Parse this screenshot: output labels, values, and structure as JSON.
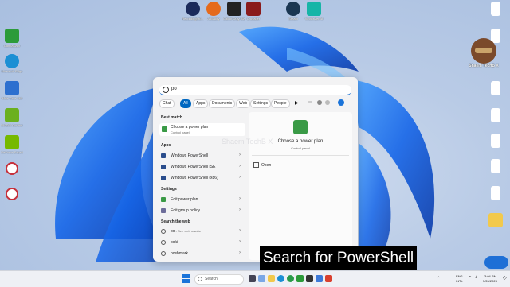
{
  "desktop_left": [
    {
      "label": "Camtasia 9",
      "color": "#2c9b3a"
    },
    {
      "label": "Microsoft Edge",
      "color": "#1b8fd4"
    },
    {
      "label": "Wise Care 365",
      "color": "#2c6fcf"
    },
    {
      "label": "NVIDIA Control Panel",
      "color": "#6bb01f"
    },
    {
      "label": "GeForce Experience",
      "color": "#76b900"
    },
    {
      "label": "",
      "color": "#c6303b"
    },
    {
      "label": "",
      "color": "#c6303b"
    }
  ],
  "desktop_top": [
    {
      "label": "RecordingStu...",
      "color": "#1b2a5a"
    },
    {
      "label": "Audacity",
      "color": "#e56a1c"
    },
    {
      "label": "Call of Duty Black Ops 3",
      "color": "#222222"
    },
    {
      "label": "Crusader",
      "color": "#8a1b1b"
    },
    {
      "label": "Steam",
      "color": "#1a3652"
    },
    {
      "label": "Vectorizer.AI",
      "color": "#17b5a7"
    }
  ],
  "desktop_right": [
    {
      "label": "Shaem TechB X",
      "color": "#ffffff"
    },
    {
      "label": "",
      "color": "#ffffff"
    },
    {
      "label": "",
      "color": "#ffffff"
    },
    {
      "label": "",
      "color": "#ffffff"
    },
    {
      "label": "",
      "color": "#ffffff"
    },
    {
      "label": "",
      "color": "#ffffff"
    },
    {
      "label": "",
      "color": "#ffffff"
    },
    {
      "label": "",
      "color": "#f2c94c"
    }
  ],
  "profile": {
    "label": "Shaem TechB X"
  },
  "start_menu": {
    "search_value": "po",
    "filters": [
      "Chat",
      "All",
      "Apps",
      "Documents",
      "Web",
      "Settings",
      "People"
    ],
    "best_match_header": "Best match",
    "best_match": {
      "title": "Choose a power plan",
      "subtitle": "Control panel"
    },
    "apps_header": "Apps",
    "apps": [
      "Windows PowerShell",
      "Windows PowerShell ISE",
      "Windows PowerShell (x86)"
    ],
    "settings_header": "Settings",
    "settings": [
      "Edit power plan",
      "Edit group policy"
    ],
    "web_header": "Search the web",
    "web": [
      {
        "text": "po",
        "sub": " - See web results"
      },
      {
        "text": "poki",
        "sub": ""
      },
      {
        "text": "poshmark",
        "sub": ""
      }
    ],
    "detail_title": "Choose a power plan",
    "detail_subtitle": "Control panel",
    "detail_open": "Open",
    "watermark": "Shaem TechB X"
  },
  "taskbar": {
    "search_placeholder": "Search",
    "tray_lang": "ENG",
    "tray_region": "INTL",
    "time": "3:04 PM",
    "date": "5/26/2023"
  },
  "caption": "Search for PowerShell"
}
